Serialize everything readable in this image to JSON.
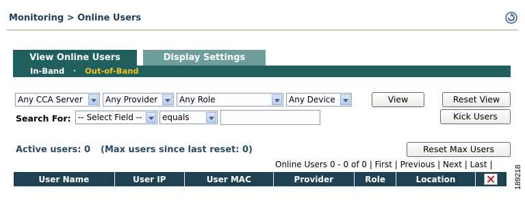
{
  "header": {
    "breadcrumb": "Monitoring > Online Users",
    "help_icon": "refresh-help-icon"
  },
  "tabs": [
    {
      "label": "View Online Users",
      "active": true
    },
    {
      "label": "Display Settings",
      "active": false
    }
  ],
  "subtabs": {
    "in_band": "In-Band",
    "separator": "·",
    "out_of_band": "Out-of-Band"
  },
  "filters": {
    "server": "Any CCA Server",
    "provider": "Any Provider",
    "role": "Any Role",
    "device": "Any Device",
    "search_label": "Search For:",
    "field": "-- Select Field --",
    "operator": "equals",
    "search_value": ""
  },
  "buttons": {
    "view": "View",
    "reset_view": "Reset View",
    "kick_users": "Kick Users",
    "reset_max_users": "Reset Max Users"
  },
  "stats": {
    "active_users": "Active users: 0",
    "max_users": "(Max users since last reset: 0)"
  },
  "pager": {
    "summary": "Online Users 0 - 0 of 0",
    "first": "First",
    "previous": "Previous",
    "next": "Next",
    "last": "Last"
  },
  "table": {
    "columns": [
      "User Name",
      "User IP",
      "User MAC",
      "Provider",
      "Role",
      "Location"
    ]
  },
  "figure_id": "189218",
  "colors": {
    "tab_active": "#1f5f5e",
    "tab_inactive": "#6d9e9b",
    "header_row": "#1f4252",
    "subtab_highlight": "#f2c21b"
  }
}
